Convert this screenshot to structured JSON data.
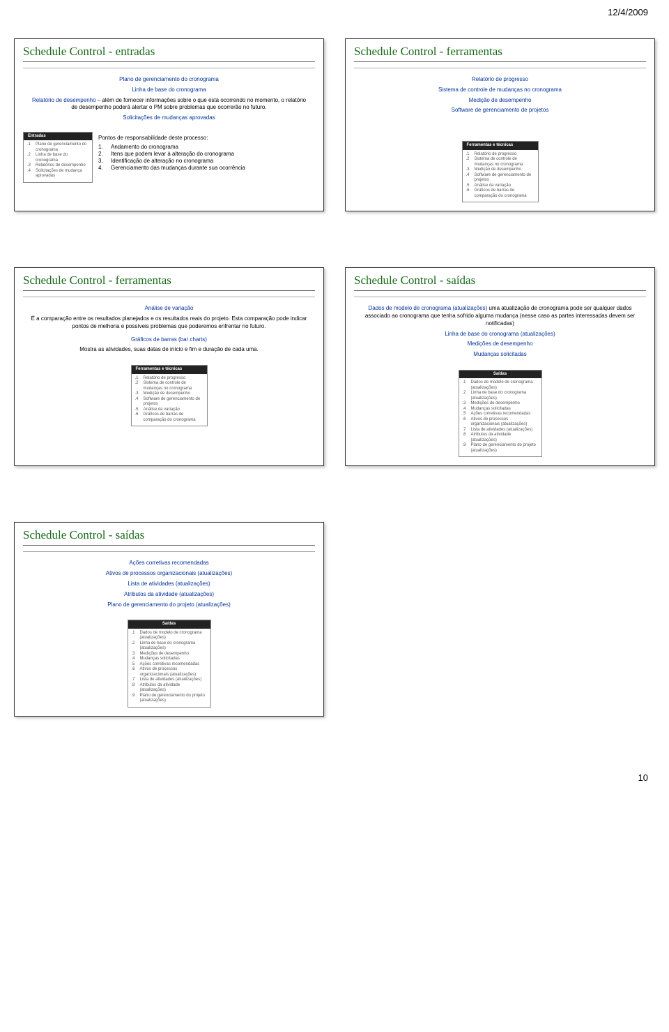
{
  "meta": {
    "date": "12/4/2009",
    "page": "10"
  },
  "slide1": {
    "title": "Schedule Control - entradas",
    "line1": "Plano de gerenciamento do cronograma",
    "line2": "Linha de base do cronograma",
    "para1_label": "Relatório de desempenho",
    "para1_text": " – além de fornecer informações sobre o que está ocorrendo no momento, o relatório de desempenho poderá alertar o PM sobre problemas que ocorrerão no futuro.",
    "line3": "Solicitações de mudanças aprovadas",
    "entradas_header": "Entradas",
    "entradas_items": [
      "Plano de gerenciamento do cronograma",
      "Linha de base do cronograma",
      "Relatórios de desempenho",
      "Solicitações de mudança aprovadas"
    ],
    "points_heading": "Pontos de responsabilidade deste processo:",
    "points": [
      "Andamento do cronograma",
      "Itens que podem levar à alteração do cronograma",
      "Identificação de alteração no cronograma",
      "Gerenciamento das mudanças durante sua ocorrência"
    ]
  },
  "slide2": {
    "title": "Schedule Control - ferramentas",
    "line1": "Relatório de progresso",
    "line2": "Sistema de controle de mudanças no cronograma",
    "line3": "Medição de desempenho",
    "line4": "Software de gerenciamento de projetos",
    "ferr_header": "Ferramentas e técnicas",
    "ferr_items": [
      "Relatório de progresso",
      "Sistema de controle de mudanças no cronograma",
      "Medição de desempenho",
      "Software de gerenciamento de projetos",
      "Análise da variação",
      "Gráficos de barras de comparação do cronograma"
    ]
  },
  "slide3": {
    "title": "Schedule Control - ferramentas",
    "h1": "Análise de variação",
    "p1": "É a comparação entre os resultados planejados e os resultados reais do projeto. Esta comparação pode indicar pontos de melhoria e possíveis problemas que poderemos enfrentar no futuro.",
    "h2": "Gráficos de barras (bar charts)",
    "p2": "Mostra as atividades, suas datas de início e fim e duração de cada uma.",
    "ferr_header": "Ferramentas e técnicas",
    "ferr_items": [
      "Relatório de progresso",
      "Sistema de controle de mudanças no cronograma",
      "Medição de desempenho",
      "Software de gerenciamento de projetos",
      "Análise da variação",
      "Gráficos de barras de comparação do cronograma"
    ]
  },
  "slide4": {
    "title": "Schedule Control - saídas",
    "p1_label": "Dados de modelo de cronograma (atualizações)",
    "p1_text": " uma atualização de cronograma pode ser qualquer dados associado ao cronograma que tenha sofrido alguma mudança (nesse caso as partes interessadas devem ser notificadas)",
    "line2": "Linha de base do cronograma (atualizações)",
    "line3": "Medições de desempenho",
    "line4": "Mudanças solicitadas",
    "saidas_header": "Saídas",
    "saidas_items": [
      "Dados de modelo de cronograma (atualizações)",
      "Linha de base do cronograma (atualizações)",
      "Medições de desempenho",
      "Mudanças solicitadas",
      "Ações corretivas recomendadas",
      "Ativos de processos organizacionais (atualizações)",
      "Lista de atividades (atualizações)",
      "Atributos da atividade (atualizações)",
      "Plano de gerenciamento do projeto (atualizações)"
    ]
  },
  "slide5": {
    "title": "Schedule Control - saídas",
    "line1": "Ações corretivas recomendadas",
    "line2": "Ativos de processos organizacionais (atualizações)",
    "line3": "Lista de atividades (atualizações)",
    "line4": "Atributos da atividade (atualizações)",
    "line5": "Plano de gerenciamento do projeto (atualizações)",
    "saidas_header": "Saídas",
    "saidas_items": [
      "Dados de modelo de cronograma (atualizações)",
      "Linha de base do cronograma (atualizações)",
      "Medições de desempenho",
      "Mudanças solicitadas",
      "Ações corretivas recomendadas",
      "Ativos de processos organizacionais (atualizações)",
      "Lista de atividades (atualizações)",
      "Atributos da atividade (atualizações)",
      "Plano de gerenciamento do projeto (atualizações)"
    ]
  }
}
